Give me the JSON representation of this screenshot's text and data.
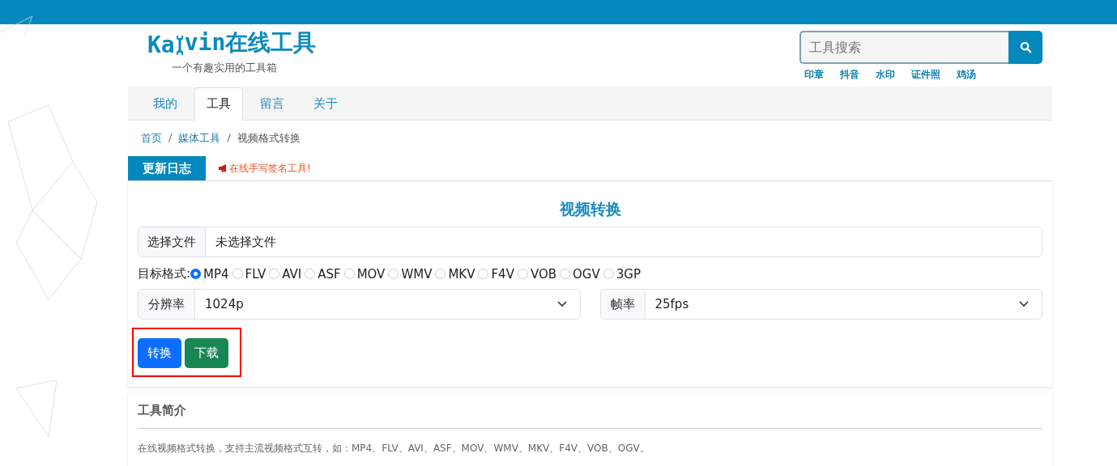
{
  "logo": {
    "prefix": "Ka",
    "suffix": "vin在线工具",
    "slogan": "一个有趣实用的工具箱"
  },
  "search": {
    "placeholder": "工具搜索",
    "hot_links": [
      "印章",
      "抖音",
      "水印",
      "证件照",
      "鸡汤"
    ]
  },
  "nav": [
    {
      "label": "我的",
      "selected": false
    },
    {
      "label": "工具",
      "selected": true
    },
    {
      "label": "留言",
      "selected": false
    },
    {
      "label": "关于",
      "selected": false
    }
  ],
  "breadcrumb": [
    {
      "label": "首页",
      "kind": "link"
    },
    {
      "label": "/",
      "kind": "separator"
    },
    {
      "label": "媒体工具",
      "kind": "link"
    },
    {
      "label": "/",
      "kind": "separator"
    },
    {
      "label": "视频格式转换",
      "kind": "current"
    }
  ],
  "update_log": {
    "title": "更新日志",
    "notice": "在线手写签名工具!"
  },
  "tool": {
    "title": "视频转换",
    "file_button": "选择文件",
    "file_value": "未选择文件",
    "format_label": "目标格式:",
    "formats": [
      {
        "label": "MP4",
        "selected": true
      },
      {
        "label": "FLV",
        "selected": false
      },
      {
        "label": "AVI",
        "selected": false
      },
      {
        "label": "ASF",
        "selected": false
      },
      {
        "label": "MOV",
        "selected": false
      },
      {
        "label": "WMV",
        "selected": false
      },
      {
        "label": "MKV",
        "selected": false
      },
      {
        "label": "F4V",
        "selected": false
      },
      {
        "label": "VOB",
        "selected": false
      },
      {
        "label": "OGV",
        "selected": false
      },
      {
        "label": "3GP",
        "selected": false
      }
    ],
    "resolution_label": "分辨率",
    "resolution_value": "1024p",
    "framerate_label": "帧率",
    "framerate_value": "25fps",
    "buttons": [
      {
        "label": "转换",
        "kind": "primary"
      },
      {
        "label": "下载",
        "kind": "success"
      }
    ]
  },
  "intro": {
    "title": "工具简介",
    "text": "在线视频格式转换，支持主流视频格式互转，如：MP4、FLV、AVI、ASF、MOV、WMV、MKV、F4V、VOB、OGV。"
  }
}
